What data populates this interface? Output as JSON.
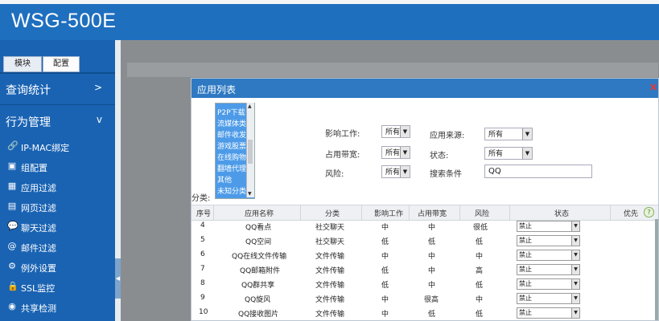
{
  "app": {
    "title": "WSG-500E"
  },
  "sidebar": {
    "tabs": [
      {
        "label": "模块"
      },
      {
        "label": "配置"
      }
    ],
    "sections": [
      {
        "label": "查询统计",
        "chevron": ">"
      },
      {
        "label": "行为管理",
        "chevron": "v"
      }
    ],
    "items": [
      {
        "label": "IP-MAC绑定",
        "icon": "link-icon",
        "glyph": "🔗"
      },
      {
        "label": "组配置",
        "icon": "group-icon",
        "glyph": "▣"
      },
      {
        "label": "应用过滤",
        "icon": "grid-icon",
        "glyph": "▦"
      },
      {
        "label": "网页过滤",
        "icon": "page-icon",
        "glyph": "▤"
      },
      {
        "label": "聊天过滤",
        "icon": "chat-icon",
        "glyph": "💬"
      },
      {
        "label": "邮件过滤",
        "icon": "at-icon",
        "glyph": "@"
      },
      {
        "label": "例外设置",
        "icon": "gear-icon",
        "glyph": "⚙"
      },
      {
        "label": "SSL监控",
        "icon": "lock-icon",
        "glyph": "🔒"
      },
      {
        "label": "共享检测",
        "icon": "share-icon",
        "glyph": "◉"
      }
    ]
  },
  "dialog": {
    "title": "应用列表",
    "close": "×",
    "category_label": "分类:",
    "categories": [
      "P2P下载",
      "流媒体类",
      "邮件收发",
      "游戏股票",
      "在线购物",
      "翻墙代理",
      "其他",
      "未知分类"
    ],
    "filters": {
      "impact_label": "影响工作:",
      "impact_value": "所有",
      "bandwidth_label": "占用带宽:",
      "bandwidth_value": "所有",
      "risk_label": "风险:",
      "risk_value": "所有",
      "source_label": "应用来源:",
      "source_value": "所有",
      "status_label": "状态:",
      "status_value": "所有",
      "search_label": "搜索条件",
      "search_value": "QQ"
    },
    "columns": [
      "序号",
      "应用名称",
      "分类",
      "影响工作",
      "占用带宽",
      "风险",
      "状态",
      "优先"
    ],
    "help_glyph": "?",
    "rows": [
      {
        "no": "4",
        "name": "QQ看点",
        "category": "社交聊天",
        "impact": "中",
        "bandwidth": "中",
        "risk": "很低",
        "status": "禁止"
      },
      {
        "no": "5",
        "name": "QQ空间",
        "category": "社交聊天",
        "impact": "低",
        "bandwidth": "低",
        "risk": "低",
        "status": "禁止"
      },
      {
        "no": "6",
        "name": "QQ在线文件传输",
        "category": "文件传输",
        "impact": "中",
        "bandwidth": "中",
        "risk": "中",
        "status": "禁止"
      },
      {
        "no": "7",
        "name": "QQ邮箱附件",
        "category": "文件传输",
        "impact": "低",
        "bandwidth": "中",
        "risk": "高",
        "status": "禁止"
      },
      {
        "no": "8",
        "name": "QQ群共享",
        "category": "文件传输",
        "impact": "低",
        "bandwidth": "中",
        "risk": "低",
        "status": "禁止"
      },
      {
        "no": "9",
        "name": "QQ旋风",
        "category": "文件传输",
        "impact": "中",
        "bandwidth": "很高",
        "risk": "中",
        "status": "禁止"
      },
      {
        "no": "10",
        "name": "QQ接收图片",
        "category": "文件传输",
        "impact": "中",
        "bandwidth": "低",
        "risk": "低",
        "status": "禁止"
      }
    ]
  }
}
